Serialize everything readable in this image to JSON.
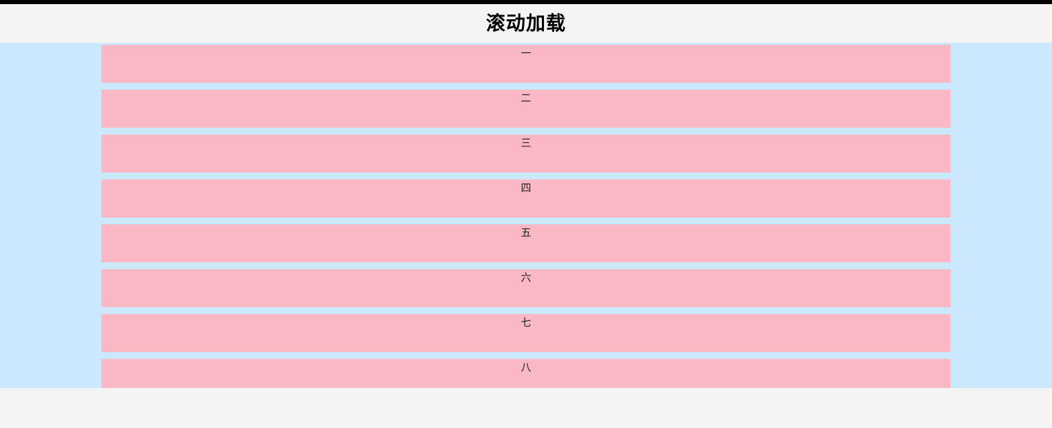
{
  "header": {
    "title": "滚动加载"
  },
  "list": {
    "items": [
      {
        "label": "一"
      },
      {
        "label": "二"
      },
      {
        "label": "三"
      },
      {
        "label": "四"
      },
      {
        "label": "五"
      },
      {
        "label": "六"
      },
      {
        "label": "七"
      },
      {
        "label": "八"
      }
    ]
  }
}
